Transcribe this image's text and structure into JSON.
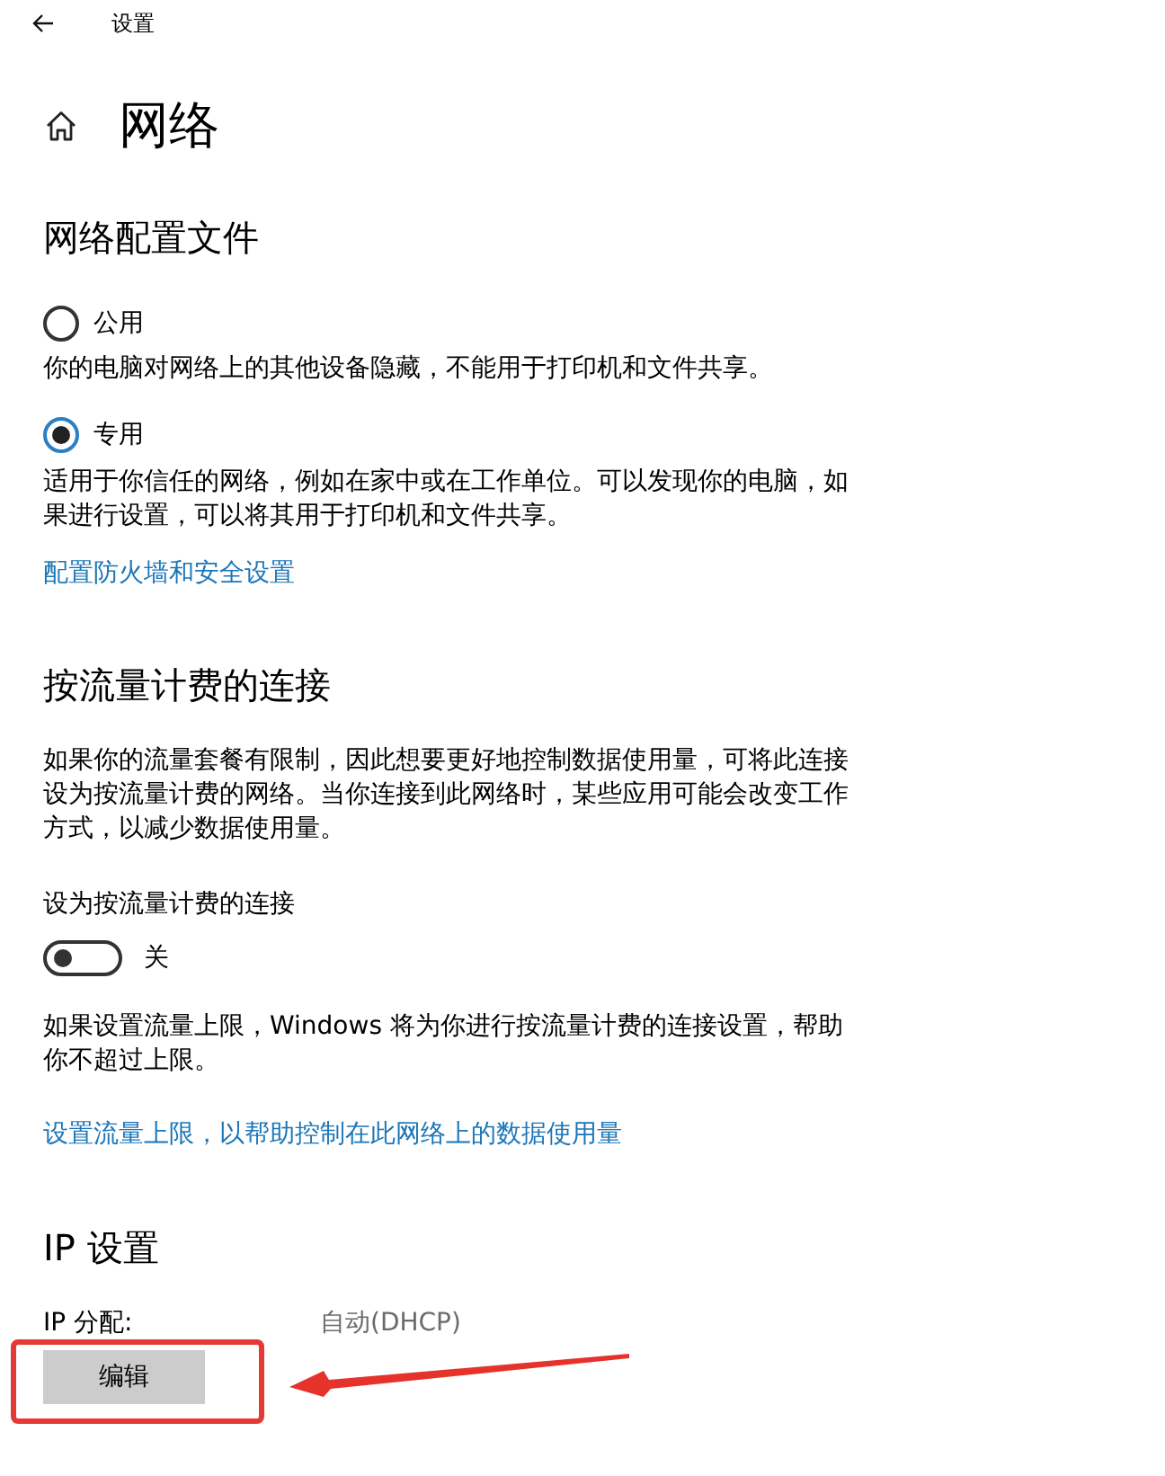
{
  "header": {
    "title": "设置"
  },
  "page": {
    "title": "网络"
  },
  "network_profile": {
    "heading": "网络配置文件",
    "options": [
      {
        "label": "公用",
        "description": "你的电脑对网络上的其他设备隐藏，不能用于打印机和文件共享。",
        "selected": false
      },
      {
        "label": "专用",
        "description": "适用于你信任的网络，例如在家中或在工作单位。可以发现你的电脑，如果进行设置，可以将其用于打印机和文件共享。",
        "selected": true
      }
    ],
    "link": "配置防火墙和安全设置"
  },
  "metered_connection": {
    "heading": "按流量计费的连接",
    "description": "如果你的流量套餐有限制，因此想要更好地控制数据使用量，可将此连接设为按流量计费的网络。当你连接到此网络时，某些应用可能会改变工作方式，以减少数据使用量。",
    "toggle": {
      "label": "设为按流量计费的连接",
      "on": false,
      "state_text": "关"
    },
    "note": "如果设置流量上限，Windows 将为你进行按流量计费的连接设置，帮助你不超过上限。",
    "link": "设置流量上限，以帮助控制在此网络上的数据使用量"
  },
  "ip_settings": {
    "heading": "IP 设置",
    "rows": [
      {
        "label": "IP 分配:",
        "value": "自动(DHCP)"
      }
    ],
    "button": "编辑"
  },
  "annotation": {
    "kind": "box_with_arrow"
  }
}
